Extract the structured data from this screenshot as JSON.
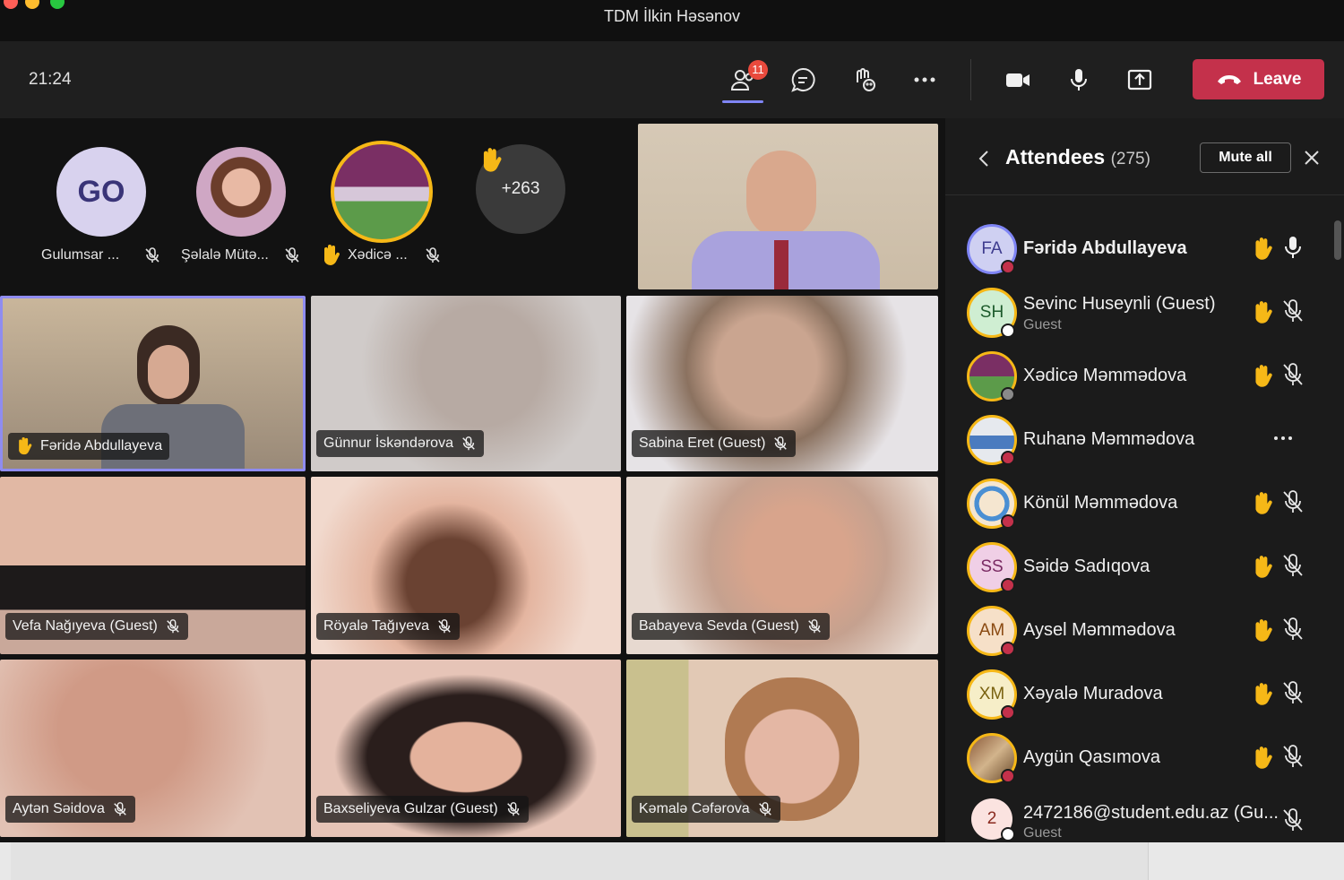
{
  "window": {
    "title": "TDM İlkin Həsənov"
  },
  "toolbar": {
    "time": "21:24",
    "participants_badge": "11",
    "buttons": [
      "participants-icon",
      "chat-icon",
      "reactions-icon",
      "more-icon",
      "camera-icon",
      "mic-icon",
      "share-icon"
    ],
    "leave_label": "Leave"
  },
  "avatars": [
    {
      "initials": "GO",
      "name": "Gulumsar ...",
      "hand": false
    },
    {
      "initials": "",
      "name": "Şəlalə Mütə...",
      "hand": false
    },
    {
      "initials": "",
      "name": "Xədicə ...",
      "hand": true
    }
  ],
  "overflow": {
    "count": "+263"
  },
  "tiles": [
    {
      "name": "Fəridə Abdullayeva",
      "hand": true,
      "muted": false
    },
    {
      "name": "Günnur İskəndərova",
      "hand": false,
      "muted": true
    },
    {
      "name": "Sabina Eret (Guest)",
      "hand": false,
      "muted": true
    },
    {
      "name": "Vefa Nağıyeva (Guest)",
      "hand": false,
      "muted": true
    },
    {
      "name": "Röyalə Tağıyeva",
      "hand": false,
      "muted": true
    },
    {
      "name": "Babayeva Sevda (Guest)",
      "hand": false,
      "muted": true
    },
    {
      "name": "Aytən Səidova",
      "hand": false,
      "muted": true
    },
    {
      "name": "Baxseliyeva Gulzar (Guest)",
      "hand": false,
      "muted": true
    },
    {
      "name": "Kəmalə Cəfərova",
      "hand": false,
      "muted": true
    }
  ],
  "panel": {
    "title": "Attendees",
    "count": "(275)",
    "mute_all_label": "Mute all",
    "attendees": [
      {
        "initials": "FA",
        "name": "Fəridə Abdullayeva",
        "sub": "",
        "hand": true,
        "mic": "on"
      },
      {
        "initials": "SH",
        "name": "Sevinc Huseynli (Guest)",
        "sub": "Guest",
        "hand": true,
        "mic": "off"
      },
      {
        "initials": "",
        "name": "Xədicə Məmmədova",
        "sub": "",
        "hand": true,
        "mic": "off"
      },
      {
        "initials": "",
        "name": "Ruhanə Məmmədova",
        "sub": "",
        "hand": false,
        "mic": "more"
      },
      {
        "initials": "",
        "name": "Könül Məmmədova",
        "sub": "",
        "hand": true,
        "mic": "off"
      },
      {
        "initials": "SS",
        "name": "Səidə Sadıqova",
        "sub": "",
        "hand": true,
        "mic": "off"
      },
      {
        "initials": "AM",
        "name": "Aysel Məmmədova",
        "sub": "",
        "hand": true,
        "mic": "off"
      },
      {
        "initials": "XM",
        "name": "Xəyalə Muradova",
        "sub": "",
        "hand": true,
        "mic": "off"
      },
      {
        "initials": "",
        "name": "Aygün Qasımova",
        "sub": "",
        "hand": true,
        "mic": "off"
      },
      {
        "initials": "2",
        "name": "2472186@student.edu.az (Gu...",
        "sub": "Guest",
        "hand": false,
        "mic": "off"
      }
    ]
  },
  "colors": {
    "accent": "#7f85f5",
    "leave": "#c4314b",
    "hand": "#f6b817",
    "away": "#e94a3d"
  }
}
